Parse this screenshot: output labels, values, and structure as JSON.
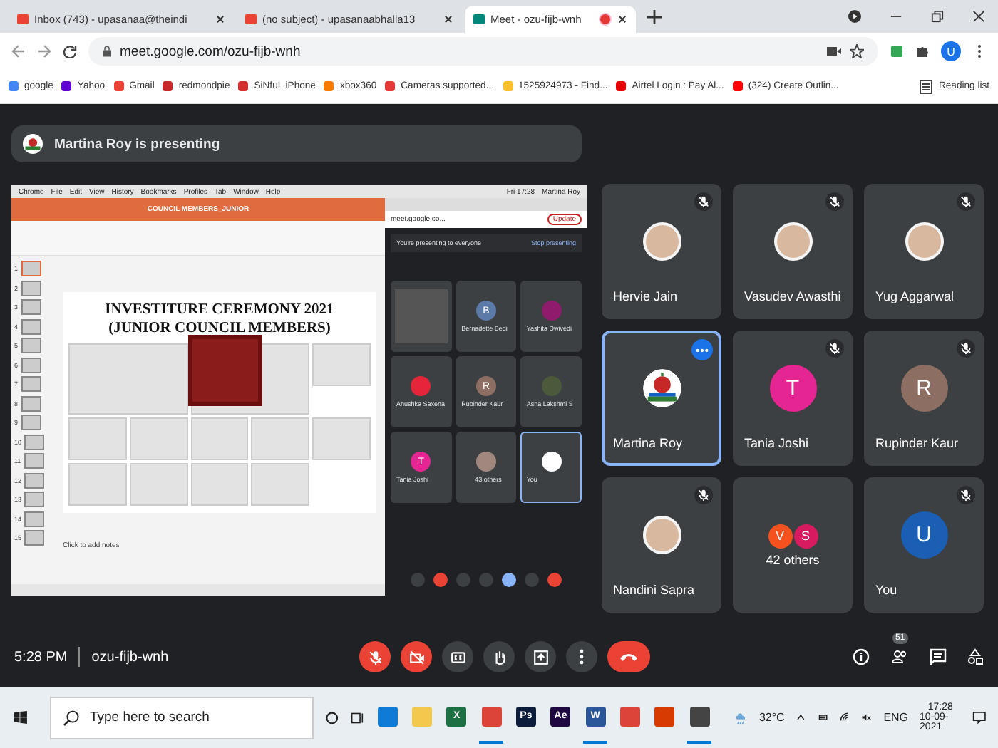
{
  "browser": {
    "tabs": [
      {
        "title": "Inbox (743) - upasanaa@theindi",
        "selected": false,
        "recording": false
      },
      {
        "title": "(no subject) - upasanaabhalla13",
        "selected": false,
        "recording": false
      },
      {
        "title": "Meet - ozu-fijb-wnh",
        "selected": true,
        "recording": true
      }
    ],
    "url": "meet.google.com/ozu-fijb-wnh",
    "profile_initial": "U",
    "bookmarks": [
      {
        "label": "google",
        "color": "#4285f4"
      },
      {
        "label": "Yahoo",
        "color": "#6001d2"
      },
      {
        "label": "Gmail",
        "color": "#ea4335"
      },
      {
        "label": "redmondpie",
        "color": "#c62828"
      },
      {
        "label": "SiNfuL iPhone",
        "color": "#d32f2f"
      },
      {
        "label": "xbox360",
        "color": "#f57c00"
      },
      {
        "label": "Cameras supported...",
        "color": "#e53935"
      },
      {
        "label": "1525924973 - Find...",
        "color": "#fbc02d"
      },
      {
        "label": "Airtel Login : Pay Al...",
        "color": "#e40000"
      },
      {
        "label": "(324) Create Outlin...",
        "color": "#ff0000"
      }
    ],
    "reading_list": "Reading list"
  },
  "meet": {
    "presenting_banner": "Martina Roy is presenting",
    "shared_screen": {
      "menu": [
        "Chrome",
        "File",
        "Edit",
        "View",
        "History",
        "Bookmarks",
        "Profiles",
        "Tab",
        "Window",
        "Help"
      ],
      "clock": "Fri 17:28",
      "user": "Martina Roy",
      "doc_title": "COUNCIL MEMBERS_JUNIOR",
      "slide_title": [
        "INVESTITURE CEREMONY 2021",
        "(JUNIOR COUNCIL MEMBERS)"
      ],
      "slide_numbers": [
        "1",
        "2",
        "3",
        "4",
        "5",
        "6",
        "7",
        "8",
        "9",
        "10",
        "11",
        "12",
        "13",
        "14",
        "15"
      ],
      "notes_placeholder": "Click to add notes",
      "mini_url": "meet.google.co...",
      "update": "Update",
      "presenting_text": "You're presenting to everyone",
      "stop_presenting": "Stop presenting",
      "tiles": [
        {
          "kind": "screen",
          "selected": false
        },
        {
          "kind": "letter",
          "name": "Bernadette Bedi",
          "initial": "B",
          "color": "#5c7aa8",
          "selected": false
        },
        {
          "kind": "photo",
          "name": "Yashita Dwivedi",
          "color": "#8e1b6b",
          "selected": false
        },
        {
          "kind": "photo",
          "name": "Anushka Saxena",
          "color": "#e5263a",
          "selected": false
        },
        {
          "kind": "letter",
          "name": "Rupinder Kaur",
          "initial": "R",
          "color": "#8d6e63",
          "selected": false
        },
        {
          "kind": "photo",
          "name": "Asha Lakshmi S",
          "color": "#4a5a3a",
          "selected": false
        },
        {
          "kind": "letter",
          "name": "Tania Joshi",
          "initial": "T",
          "color": "#e52592",
          "selected": false
        },
        {
          "kind": "group",
          "name": "43 others",
          "color": "#a1887f",
          "selected": false
        },
        {
          "kind": "logo",
          "name": "You",
          "color": "#ffffff",
          "selected": true
        }
      ]
    },
    "participants": [
      {
        "kind": "photo",
        "name": "Hervie Jain",
        "muted": true,
        "selected": false
      },
      {
        "kind": "photo",
        "name": "Vasudev Awasthi",
        "muted": true,
        "selected": false
      },
      {
        "kind": "photo",
        "name": "Yug Aggarwal",
        "muted": true,
        "selected": false
      },
      {
        "kind": "logo",
        "name": "Martina Roy",
        "muted": false,
        "selected": true
      },
      {
        "kind": "letter",
        "name": "Tania Joshi",
        "initial": "T",
        "color": "#e52592",
        "muted": true,
        "selected": false
      },
      {
        "kind": "letter",
        "name": "Rupinder Kaur",
        "initial": "R",
        "color": "#8d6e63",
        "muted": true,
        "selected": false
      },
      {
        "kind": "photo",
        "name": "Nandini Sapra",
        "muted": true,
        "selected": false
      },
      {
        "kind": "group",
        "name": "42 others",
        "avatars": [
          {
            "initial": "V",
            "color": "#f4511e"
          },
          {
            "initial": "S",
            "color": "#d81b60"
          }
        ],
        "muted": false,
        "selected": false
      },
      {
        "kind": "letter",
        "name": "You",
        "initial": "U",
        "color": "#1a5fb4",
        "muted": true,
        "selected": false
      }
    ],
    "time": "5:28 PM",
    "meeting_code": "ozu-fijb-wnh",
    "mic_on": false,
    "camera_on": false,
    "people_count": "51"
  },
  "taskbar": {
    "search_placeholder": "Type here to search",
    "apps": [
      {
        "kind": "edge",
        "running": false
      },
      {
        "kind": "folder",
        "running": false
      },
      {
        "kind": "excel",
        "label": "X",
        "running": false
      },
      {
        "kind": "chrome",
        "running": true
      },
      {
        "kind": "ps",
        "label": "Ps",
        "running": false
      },
      {
        "kind": "ae",
        "label": "Ae",
        "running": false
      },
      {
        "kind": "word",
        "label": "W",
        "running": true
      },
      {
        "kind": "chrome",
        "running": false
      },
      {
        "kind": "office",
        "running": false
      },
      {
        "kind": "settings",
        "running": true
      }
    ],
    "temperature": "32°C",
    "language": "ENG",
    "time": "17:28",
    "date": "10-09-2021"
  }
}
